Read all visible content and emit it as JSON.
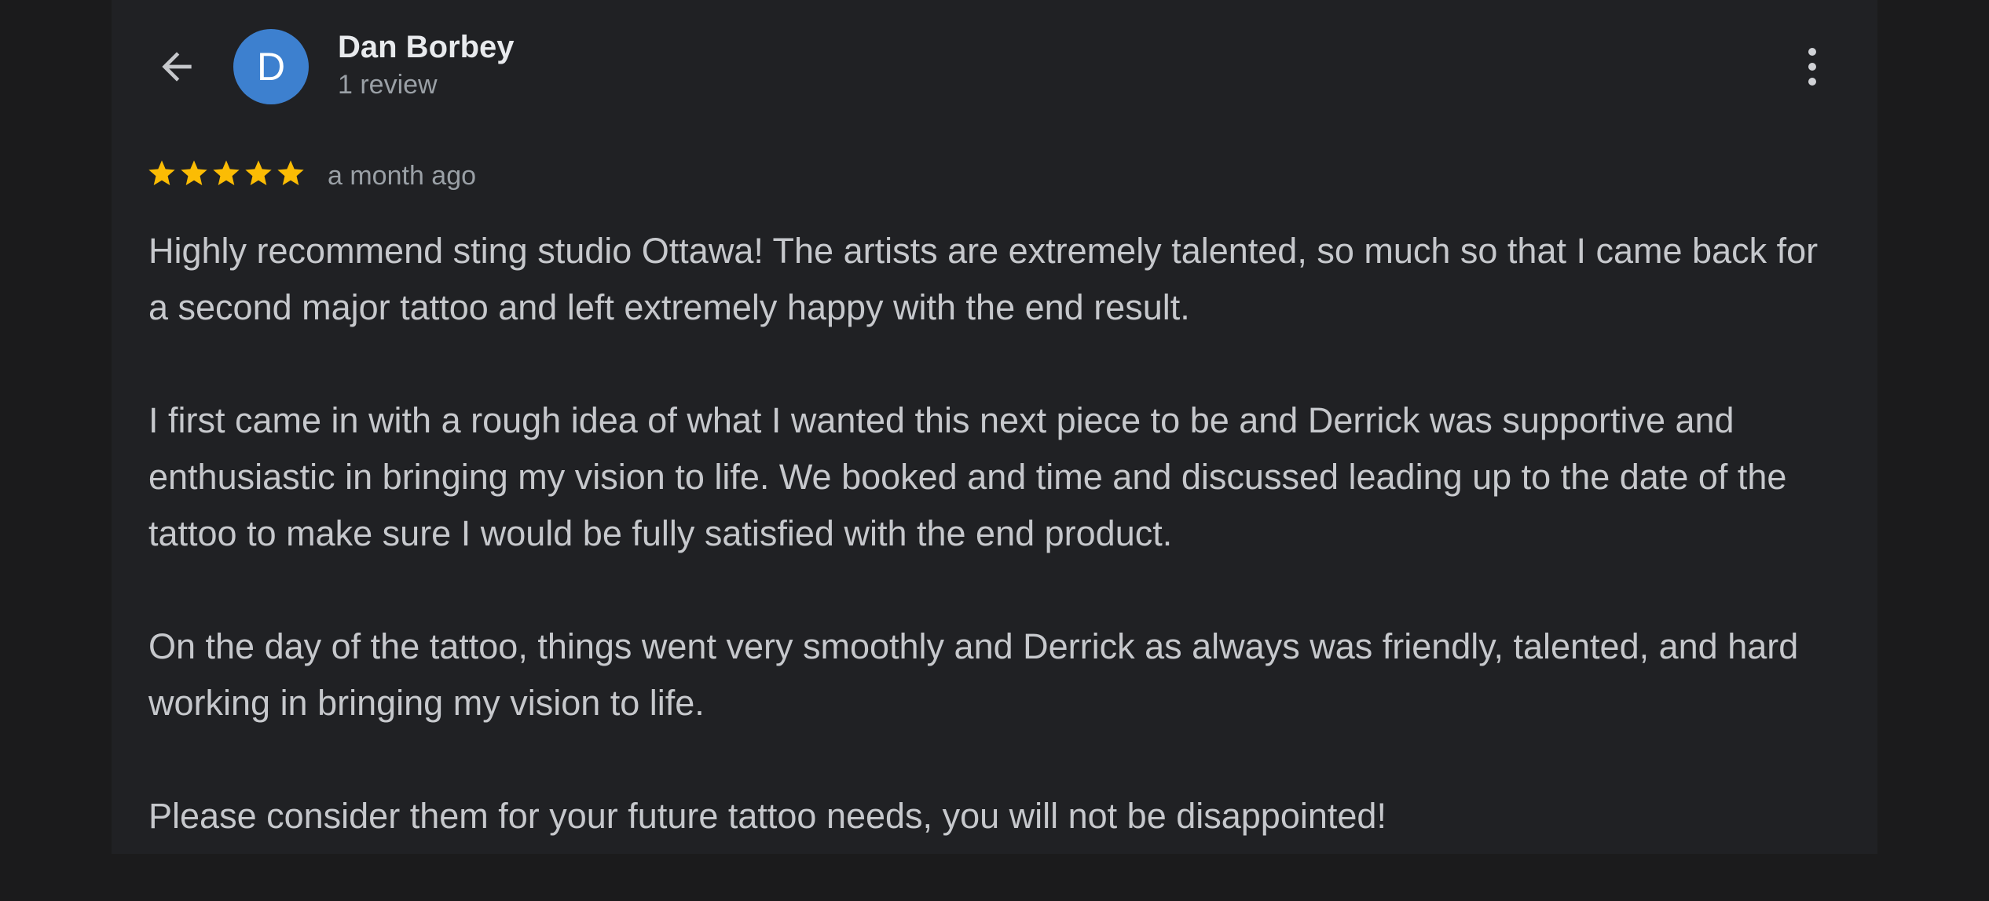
{
  "reviewer": {
    "initial": "D",
    "name": "Dan Borbey",
    "review_count": "1 review",
    "avatar_color": "#3d80cf"
  },
  "review": {
    "rating": 5,
    "max_rating": 5,
    "time_ago": "a month ago",
    "paragraphs": [
      "Highly recommend sting studio Ottawa! The artists are extremely talented, so much so that I came back for a second major tattoo and left extremely happy with the end result.",
      "I first came in with a rough idea of what I wanted this next piece to be and Derrick was supportive and enthusiastic in bringing my vision to life. We booked and time and discussed leading up to the date of the tattoo to make sure I would be fully satisfied with the end product.",
      "On the day of the tattoo, things went very smoothly and Derrick as always was friendly, talented, and hard working in bringing my vision to life.",
      "Please consider them for your future tattoo needs, you will not be disappointed!"
    ]
  },
  "icons": {
    "back": "arrow-back-icon",
    "more": "more-vert-icon",
    "star": "star-icon"
  },
  "colors": {
    "background": "#202124",
    "star": "#fbbc04",
    "text_primary": "#e8eaed",
    "text_secondary": "#9aa0a6"
  }
}
